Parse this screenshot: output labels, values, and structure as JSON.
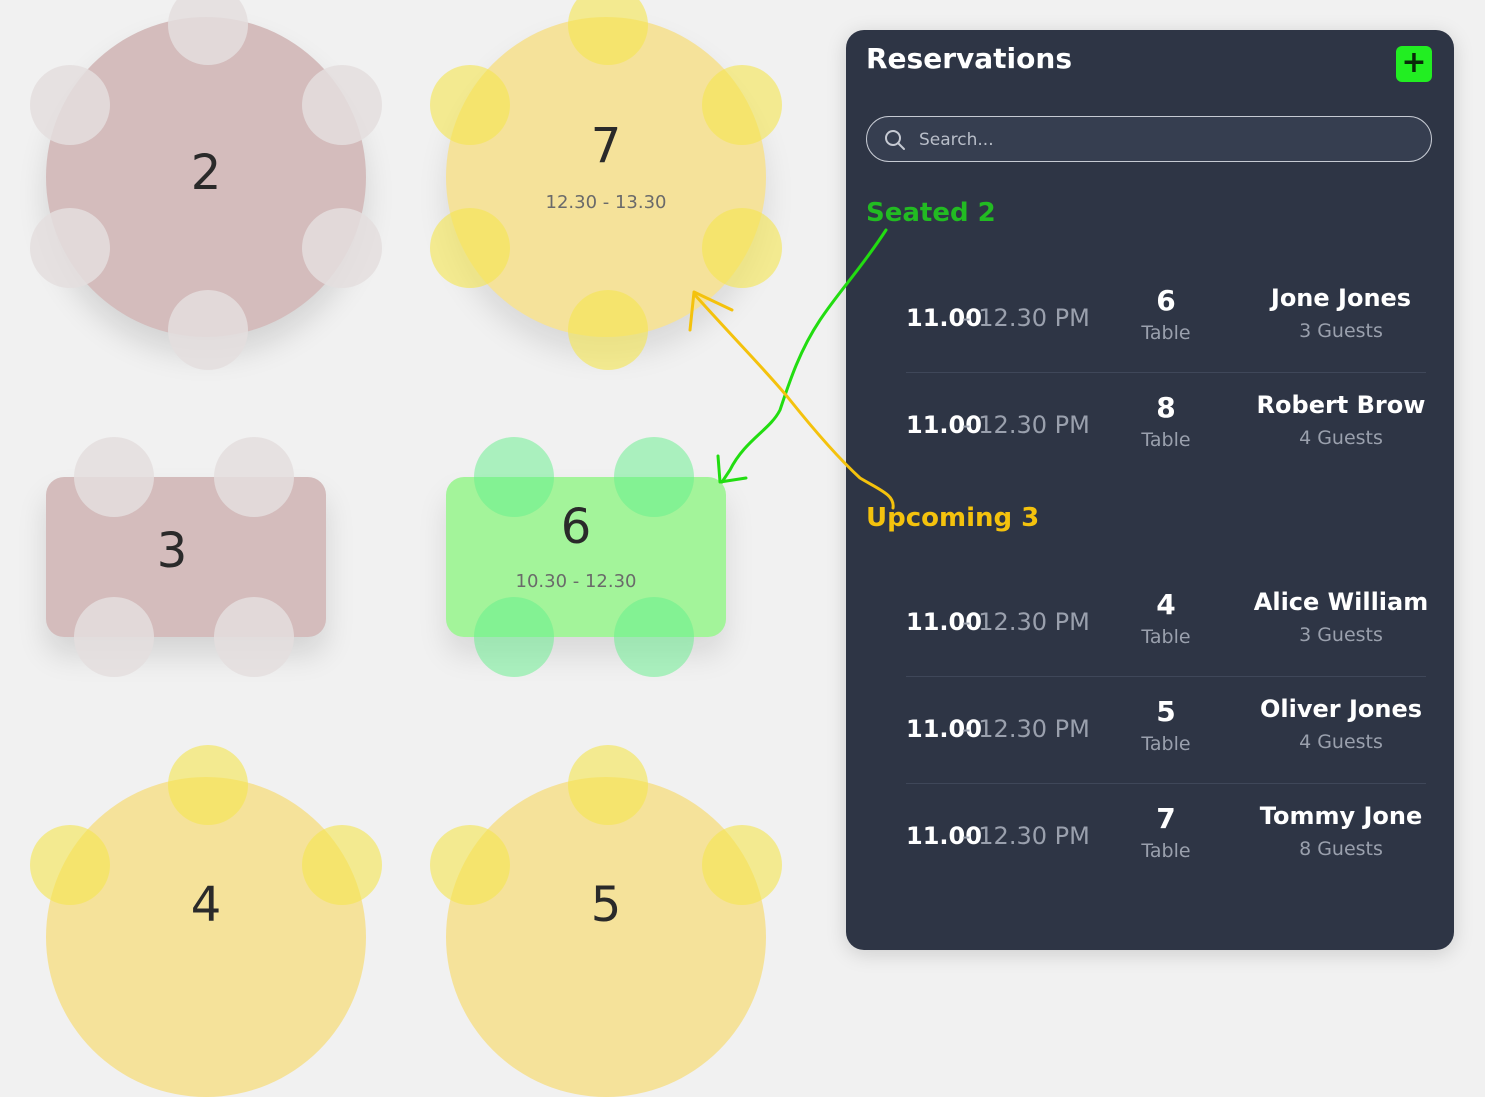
{
  "colors": {
    "reserved_table": "#d4bcbc",
    "upcoming_table": "#f5e29a",
    "seated_table": "#a3f49a",
    "panel_bg": "#2e3545",
    "seated_accent": "#22bb22",
    "upcoming_accent": "#f4c20d",
    "add_button": "#22ee22"
  },
  "floor": {
    "tables": [
      {
        "number": "2",
        "shape": "round",
        "status": "reserved",
        "time": ""
      },
      {
        "number": "7",
        "shape": "round",
        "status": "upcoming",
        "time": "12.30 - 13.30"
      },
      {
        "number": "3",
        "shape": "rect",
        "status": "reserved",
        "time": ""
      },
      {
        "number": "6",
        "shape": "rect",
        "status": "seated",
        "time": "10.30 - 12.30"
      },
      {
        "number": "4",
        "shape": "round",
        "status": "upcoming",
        "time": ""
      },
      {
        "number": "5",
        "shape": "round",
        "status": "upcoming",
        "time": ""
      }
    ]
  },
  "panel": {
    "title": "Reservations",
    "add_icon": "plus-icon",
    "search": {
      "placeholder": "Search...",
      "icon": "search-icon"
    },
    "seated": {
      "label": "Seated 2",
      "items": [
        {
          "start": "11.00",
          "end": "- 12.30 PM",
          "table": "6",
          "table_label": "Table",
          "name": "Jone Jones",
          "guests": "3 Guests"
        },
        {
          "start": "11.00",
          "end": "- 12.30 PM",
          "table": "8",
          "table_label": "Table",
          "name": "Robert Brow",
          "guests": "4 Guests"
        }
      ]
    },
    "upcoming": {
      "label": "Upcoming 3",
      "items": [
        {
          "start": "11.00",
          "end": "- 12.30 PM",
          "table": "4",
          "table_label": "Table",
          "name": "Alice William",
          "guests": "3 Guests"
        },
        {
          "start": "11.00",
          "end": "- 12.30 PM",
          "table": "5",
          "table_label": "Table",
          "name": "Oliver Jones",
          "guests": "4 Guests"
        },
        {
          "start": "11.00",
          "end": "- 12.30 PM",
          "table": "7",
          "table_label": "Table",
          "name": "Tommy Jone",
          "guests": "8 Guests"
        }
      ]
    }
  }
}
